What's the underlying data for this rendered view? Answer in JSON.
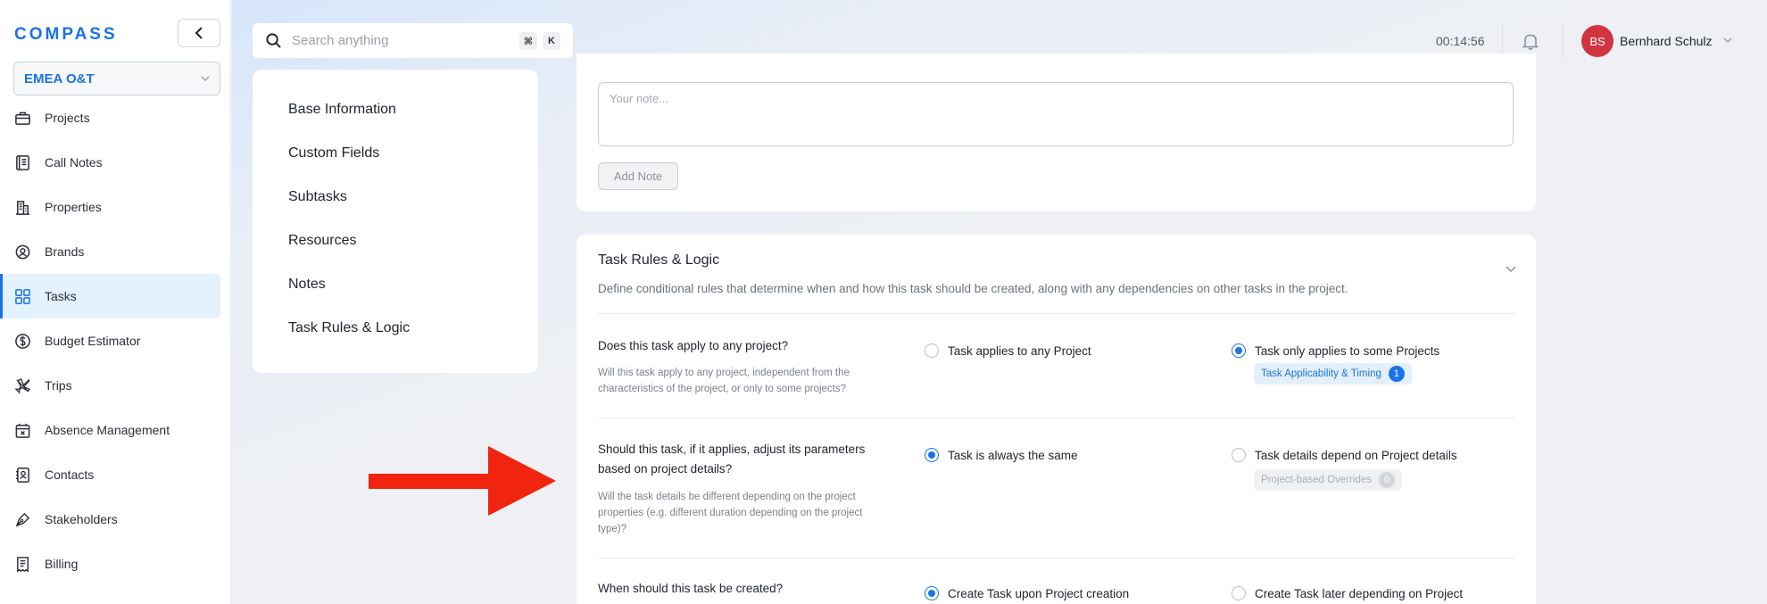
{
  "app": {
    "logo": "COMPASS",
    "org": "EMEA O&T"
  },
  "sidebar": {
    "items": [
      {
        "label": "Projects",
        "icon": "briefcase-icon"
      },
      {
        "label": "Call Notes",
        "icon": "notebook-icon"
      },
      {
        "label": "Properties",
        "icon": "building-icon"
      },
      {
        "label": "Brands",
        "icon": "badge-icon"
      },
      {
        "label": "Tasks",
        "icon": "grid-icon",
        "active": true
      },
      {
        "label": "Budget Estimator",
        "icon": "dollar-icon"
      },
      {
        "label": "Trips",
        "icon": "plane-icon"
      },
      {
        "label": "Absence Management",
        "icon": "calendar-x-icon"
      },
      {
        "label": "Contacts",
        "icon": "contact-book-icon"
      },
      {
        "label": "Stakeholders",
        "icon": "pen-icon"
      },
      {
        "label": "Billing",
        "icon": "receipt-icon"
      }
    ]
  },
  "topbar": {
    "search_placeholder": "Search anything",
    "kbd1": "⌘",
    "kbd2": "K",
    "timer": "00:14:56",
    "avatar_initials": "BS",
    "username": "Bernhard Schulz"
  },
  "section_nav": [
    "Base Information",
    "Custom Fields",
    "Subtasks",
    "Resources",
    "Notes",
    "Task Rules & Logic"
  ],
  "notes": {
    "placeholder": "Your note...",
    "add_label": "Add Note"
  },
  "rules": {
    "title": "Task Rules & Logic",
    "description": "Define conditional rules that determine when and how this task should be created, along with any dependencies on other tasks in the project.",
    "q1": {
      "question": "Does this task apply to any project?",
      "help": "Will this task apply to any project, independent from the characteristics of the project, or only to some projects?",
      "opt_a": "Task applies to any Project",
      "opt_b": "Task only applies to some Projects",
      "selected": "b",
      "tag_label": "Task Applicability & Timing",
      "tag_count": "1"
    },
    "q2": {
      "question": "Should this task, if it applies, adjust its parameters based on project details?",
      "help": "Will the task details be different depending on the project properties (e.g. different duration depending on the project type)?",
      "opt_a": "Task is always the same",
      "opt_b": "Task details depend on Project details",
      "selected": "a",
      "tag_label": "Project-based Overrides",
      "tag_count": "0"
    },
    "q3": {
      "question": "When should this task be created?",
      "opt_a": "Create Task upon Project creation",
      "opt_b": "Create Task later depending on Project",
      "selected": "a"
    }
  },
  "colors": {
    "accent": "#1a73e8",
    "avatar": "#d1343f",
    "annotation_arrow": "#f0240f"
  }
}
